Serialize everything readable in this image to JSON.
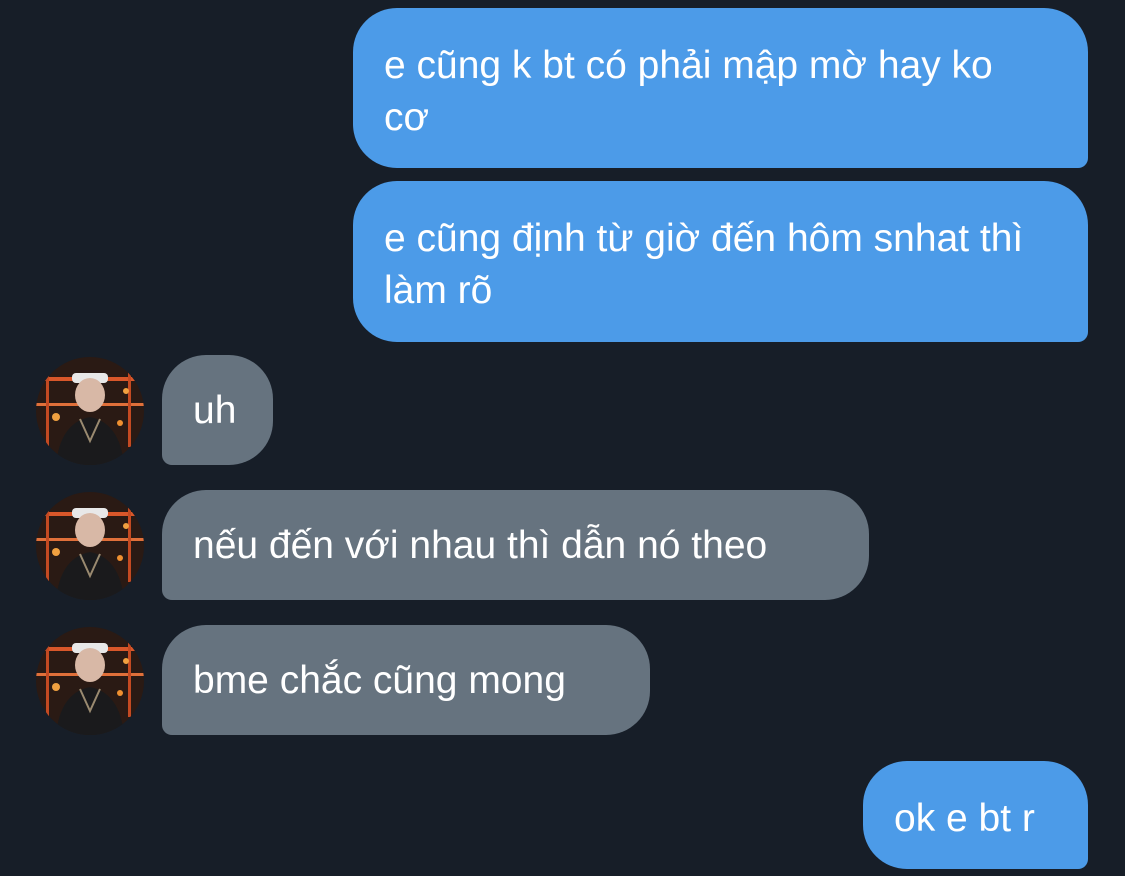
{
  "messages": [
    {
      "direction": "outgoing",
      "text": "e cũng k bt có phải mập mờ hay ko cơ"
    },
    {
      "direction": "outgoing",
      "text": "e cũng định từ giờ đến hôm snhat thì làm rõ"
    },
    {
      "direction": "incoming",
      "text": "uh",
      "avatar": "contact-photo"
    },
    {
      "direction": "incoming",
      "text": "nếu đến với nhau thì dẫn nó theo",
      "avatar": "contact-photo"
    },
    {
      "direction": "incoming",
      "text": "bme chắc cũng mong",
      "avatar": "contact-photo"
    },
    {
      "direction": "outgoing",
      "text": "ok e bt r"
    }
  ],
  "colors": {
    "background": "#171e28",
    "outgoing_bubble": "#4c9be8",
    "incoming_bubble": "#66737f",
    "text": "#ffffff"
  }
}
